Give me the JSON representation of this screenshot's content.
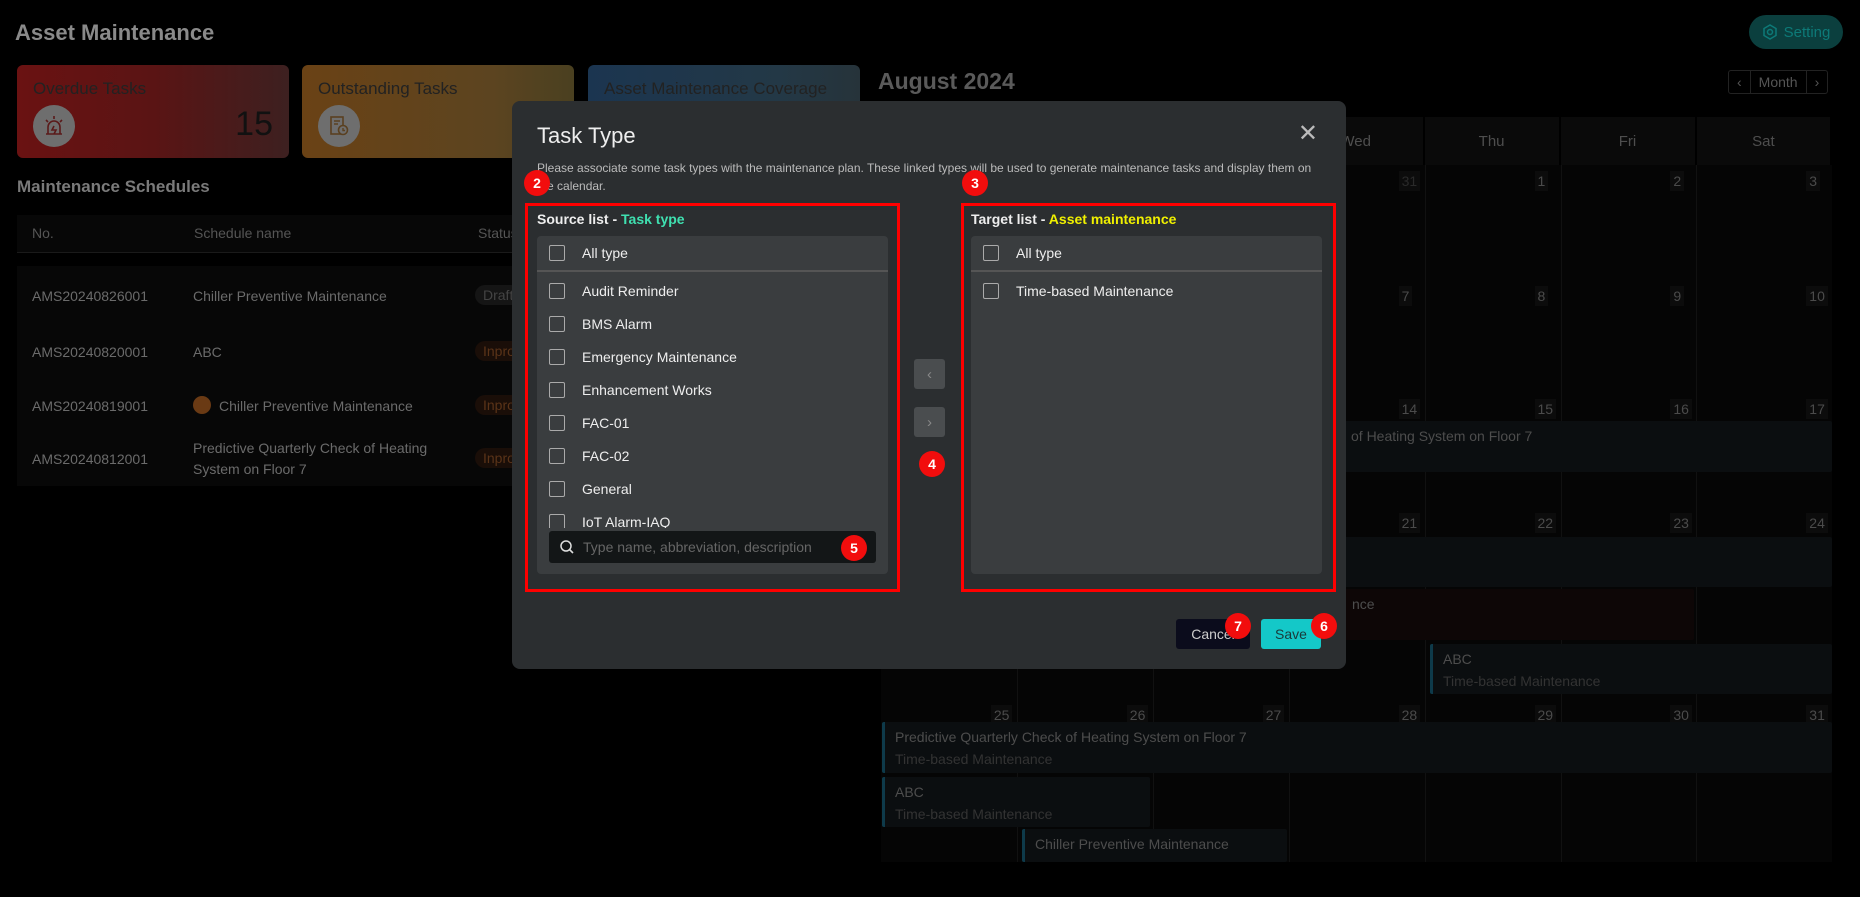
{
  "header": {
    "title": "Asset Maintenance",
    "setting_label": "Setting"
  },
  "cards": [
    {
      "label": "Overdue Tasks",
      "value": "15",
      "icon": "alarm-siren-icon"
    },
    {
      "label": "Outstanding Tasks",
      "value": "",
      "icon": "document-clock-icon"
    },
    {
      "label": "Asset Maintenance Coverage",
      "value": ""
    }
  ],
  "schedules": {
    "title": "Maintenance Schedules",
    "columns": [
      "No.",
      "Schedule name",
      "Status"
    ],
    "rows": [
      {
        "no": "AMS20240826001",
        "name": "Chiller Preventive Maintenance",
        "status": "Draft",
        "warning": false
      },
      {
        "no": "AMS20240820001",
        "name": "ABC",
        "status": "Inprogress",
        "warning": false
      },
      {
        "no": "AMS20240819001",
        "name": "Chiller Preventive Maintenance",
        "status": "Inprogress",
        "warning": true
      },
      {
        "no": "AMS20240812001",
        "name": "Predictive Quarterly Check of Heating System on Floor 7",
        "status": "Inprogress",
        "warning": false
      }
    ]
  },
  "calendar": {
    "month_title": "August 2024",
    "nav": {
      "prev": "‹",
      "view": "Month",
      "next": "›"
    },
    "visible_days": [
      "Wed",
      "Thu",
      "Fri",
      "Sat"
    ],
    "weeks": [
      {
        "dates": [
          "31",
          "1",
          "2",
          "3"
        ]
      },
      {
        "dates": [
          "7",
          "8",
          "9",
          "10"
        ]
      },
      {
        "dates": [
          "14",
          "15",
          "16",
          "17"
        ]
      },
      {
        "dates": [
          "21",
          "22",
          "23",
          "24"
        ]
      },
      {
        "dates": [
          "25",
          "26",
          "27",
          "28",
          "29",
          "30",
          "31"
        ]
      }
    ],
    "events": {
      "w3_bar": "of Heating System on Floor 7",
      "w4_red": "nce",
      "w4_abc": {
        "title": "ABC",
        "type": "Time-based Maintenance"
      },
      "w5_pred": {
        "title": "Predictive Quarterly Check of Heating System on Floor 7",
        "type": "Time-based Maintenance"
      },
      "w5_abc": {
        "title": "ABC",
        "type": "Time-based Maintenance"
      },
      "w5_chiller": {
        "title": "Chiller Preventive Maintenance"
      }
    }
  },
  "modal": {
    "title": "Task Type",
    "description": "Please associate some task types with the maintenance plan. These linked types will be used to generate maintenance tasks and display them on the calendar.",
    "source": {
      "label": "Source list - ",
      "label_accent": "Task type",
      "accent_color": "#3fe0b0",
      "all_label": "All type",
      "items": [
        "Audit Reminder",
        "BMS Alarm",
        "Emergency Maintenance",
        "Enhancement Works",
        "FAC-01",
        "FAC-02",
        "General",
        "IoT Alarm-IAQ"
      ],
      "search_placeholder": "Type name, abbreviation, description"
    },
    "target": {
      "label": "Target list - ",
      "label_accent": "Asset maintenance",
      "accent_color": "#f0f000",
      "all_label": "All type",
      "items": [
        "Time-based Maintenance"
      ]
    },
    "move_left": "‹",
    "move_right": "›",
    "cancel_label": "Cancel",
    "save_label": "Save"
  },
  "annotations": [
    "2",
    "3",
    "4",
    "5",
    "6",
    "7"
  ],
  "colors": {
    "accent": "#14c8c8",
    "annotation": "#f20d0d"
  }
}
